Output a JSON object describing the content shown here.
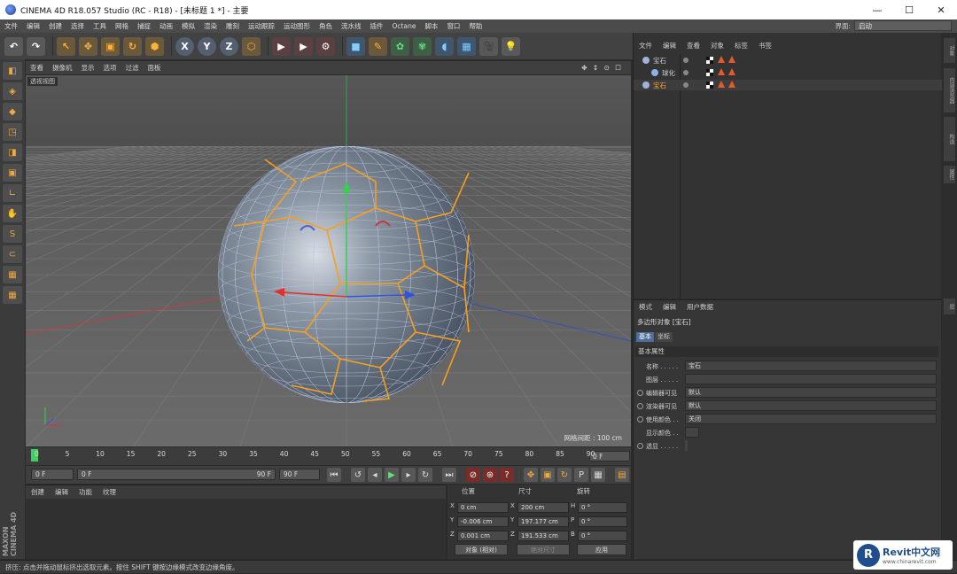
{
  "window": {
    "title": "CINEMA 4D R18.057 Studio (RC - R18) - [未标题 1 *] - 主要",
    "controls": [
      "—",
      "☐",
      "✕"
    ]
  },
  "menu": {
    "items": [
      "文件",
      "编辑",
      "创建",
      "选择",
      "工具",
      "网格",
      "捕捉",
      "动画",
      "模拟",
      "渲染",
      "雕刻",
      "运动跟踪",
      "运动图形",
      "角色",
      "流水线",
      "插件",
      "Octane",
      "脚本",
      "窗口",
      "帮助"
    ],
    "layout_label": "界面:",
    "layout_value": "启动"
  },
  "toolbar": {
    "buttons": [
      {
        "name": "undo",
        "glyph": "↶"
      },
      {
        "name": "redo",
        "glyph": "↷"
      },
      {
        "name": "live-select",
        "glyph": "↖"
      },
      {
        "name": "move",
        "glyph": "✥"
      },
      {
        "name": "scale",
        "glyph": "▣"
      },
      {
        "name": "rotate",
        "glyph": "↻"
      },
      {
        "name": "recent-tool",
        "glyph": "⬢"
      },
      {
        "name": "axis-x",
        "glyph": "X"
      },
      {
        "name": "axis-y",
        "glyph": "Y"
      },
      {
        "name": "axis-z",
        "glyph": "Z"
      },
      {
        "name": "coord-system",
        "glyph": "⬡"
      },
      {
        "name": "render-view",
        "glyph": "▶"
      },
      {
        "name": "render-picture-viewer",
        "glyph": "▶"
      },
      {
        "name": "render-settings",
        "glyph": "⚙"
      },
      {
        "name": "cube",
        "glyph": "■"
      },
      {
        "name": "pen",
        "glyph": "✎"
      },
      {
        "name": "subdivision",
        "glyph": "✿"
      },
      {
        "name": "array",
        "glyph": "✾"
      },
      {
        "name": "deformer",
        "glyph": "◖"
      },
      {
        "name": "floor",
        "glyph": "▦"
      },
      {
        "name": "camera",
        "glyph": "🎥"
      },
      {
        "name": "light",
        "glyph": "💡"
      }
    ]
  },
  "left_toolbar": {
    "tools": [
      "◧",
      "◈",
      "◆",
      "◳",
      "◨",
      "▣",
      "∟",
      "✋",
      "S",
      "⊂",
      "▦",
      "▦"
    ]
  },
  "viewport": {
    "menu": [
      "查看",
      "摄像机",
      "显示",
      "选项",
      "过滤",
      "面板"
    ],
    "icons": "✥ ↕ ⊙ ☐",
    "label": "透视视图",
    "grid_info": "网格间距 : 100 cm"
  },
  "timeline": {
    "ticks": [
      "0",
      "5",
      "10",
      "15",
      "20",
      "25",
      "30",
      "35",
      "40",
      "45",
      "50",
      "55",
      "60",
      "65",
      "70",
      "75",
      "80",
      "85",
      "90"
    ],
    "current_box": "0 F"
  },
  "playback": {
    "start": "0 F",
    "range_start": "0 F",
    "range_end": "90 F",
    "end": "90 F"
  },
  "material": {
    "menu": [
      "创建",
      "编辑",
      "功能",
      "纹理"
    ]
  },
  "coords": {
    "headers": [
      "位置",
      "尺寸",
      "旋转"
    ],
    "rows": [
      {
        "axis": "X",
        "pos": "0 cm",
        "size_axis": "X",
        "size": "200 cm",
        "rot_axis": "H",
        "rot": "0 °"
      },
      {
        "axis": "Y",
        "pos": "-0.006 cm",
        "size_axis": "Y",
        "size": "197.177 cm",
        "rot_axis": "P",
        "rot": "0 °"
      },
      {
        "axis": "Z",
        "pos": "0.001 cm",
        "size_axis": "Z",
        "size": "191.533 cm",
        "rot_axis": "B",
        "rot": "0 °"
      }
    ],
    "mode": "对象 (相对)",
    "size_mode": "绝对尺寸",
    "apply": "应用"
  },
  "objects": {
    "menu": [
      "文件",
      "编辑",
      "查看",
      "对象",
      "标签",
      "书签"
    ],
    "items": [
      {
        "name": "宝石",
        "indent": 0,
        "color": "#cfcfcf"
      },
      {
        "name": "球化",
        "indent": 1,
        "color": "#cfcfcf"
      },
      {
        "name": "宝石",
        "indent": 0,
        "color": "#f2a93b"
      }
    ]
  },
  "attributes": {
    "menu": [
      "模式",
      "编辑",
      "用户数据"
    ],
    "title": "多边形对象 [宝石]",
    "tabs": [
      "基本",
      "坐标"
    ],
    "section": "基本属性",
    "fields": [
      {
        "label": "名称 . . . . .",
        "value": "宝石",
        "radio": false
      },
      {
        "label": "图层 . . . . .",
        "value": "",
        "radio": false
      },
      {
        "label": "编辑器可见",
        "value": "默认",
        "radio": true
      },
      {
        "label": "渲染器可见",
        "value": "默认",
        "radio": true
      },
      {
        "label": "使用颜色 . .",
        "value": "关闭",
        "radio": true
      },
      {
        "label": "显示颜色 . .",
        "value": "",
        "radio": false
      },
      {
        "label": "透显 . . . . .",
        "value": "",
        "radio": true
      }
    ]
  },
  "right_tabs": [
    "对象",
    "内容浏览器",
    "构造",
    "属性",
    "层"
  ],
  "status": {
    "text": "挤压: 点击并拖动鼠标挤出选取元素。按住 SHIFT 键按边缘模式改变边缘角度。"
  },
  "watermark": {
    "text": "Revit中文网",
    "url": "www.chinarevit.com"
  },
  "maxon": "MAXON CINEMA 4D",
  "colors": {
    "accent": "#f2a93b",
    "axis_x": "#e03030",
    "axis_y": "#30c040",
    "axis_z": "#3050e0"
  }
}
